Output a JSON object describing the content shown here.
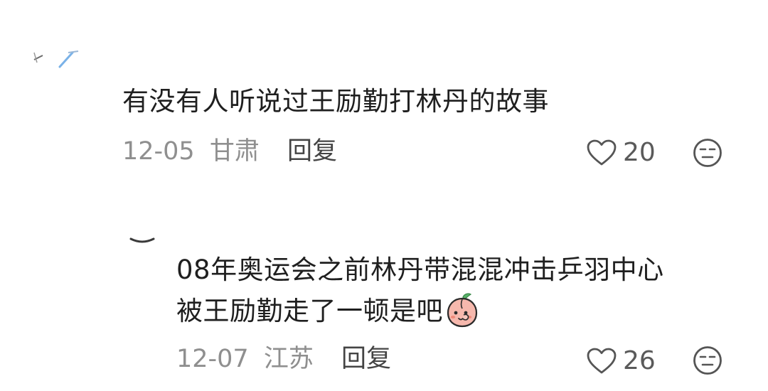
{
  "comments": [
    {
      "text": "有没有人听说过王励勤打林丹的故事",
      "date": "12-05",
      "location": "甘肃",
      "reply_label": "回复",
      "likes": "20"
    },
    {
      "text_line1": "08年奥运会之前林丹带混混冲击乒羽中心",
      "text_line2": "被王励勤走了一顿是吧",
      "date": "12-07",
      "location": "江苏",
      "reply_label": "回复",
      "likes": "26"
    }
  ],
  "icons": {
    "like": "heart-outline-icon",
    "dislike": "neutral-face-icon",
    "emoji": "peach-face-emoji"
  }
}
